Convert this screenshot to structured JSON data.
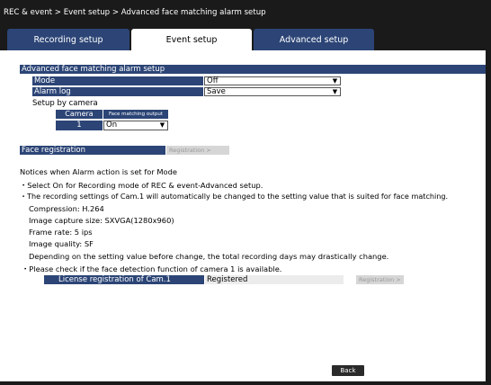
{
  "breadcrumb": "REC & event > Event setup > Advanced face matching alarm setup",
  "tabs": [
    {
      "label": "Recording setup",
      "active": false
    },
    {
      "label": "Event setup",
      "active": true
    },
    {
      "label": "Advanced setup",
      "active": false
    }
  ],
  "section_title": "Advanced face matching alarm setup",
  "settings": {
    "mode": {
      "label": "Mode",
      "value": "Off"
    },
    "alarm_log": {
      "label": "Alarm log",
      "value": "Save"
    }
  },
  "setup_by_camera": {
    "label": "Setup by camera",
    "col_camera": "Camera",
    "col_output": "Face matching output",
    "rows": [
      {
        "camera": "1",
        "output": "On"
      }
    ]
  },
  "face_registration": {
    "label": "Face registration",
    "button": "Registration >"
  },
  "notices": [
    "Notices when Alarm action is set for Mode",
    "・Select On for Recording mode of REC & event-Advanced setup.",
    "・The recording settings of Cam.1 will automatically be changed to the setting value that is suited for face matching.",
    "Compression: H.264",
    "Image capture size: SXVGA(1280x960)",
    "Frame rate: 5 ips",
    "Image quality: SF",
    "Depending on the setting value before change, the total recording days may drastically change.",
    "・Please check if the face detection function of camera 1 is available."
  ],
  "license": {
    "label": "License registration of Cam.1",
    "value": "Registered",
    "button": "Registration >"
  },
  "back_button": "Back",
  "colors": {
    "accent": "#2c4576",
    "chrome": "#1a1a1a"
  }
}
